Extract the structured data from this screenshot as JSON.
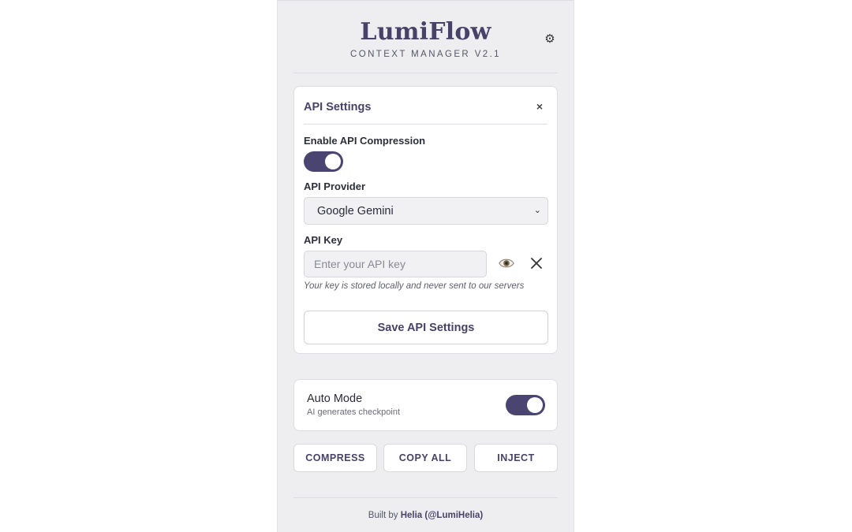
{
  "header": {
    "title": "LumiFlow",
    "subtitle": "CONTEXT MANAGER V2.1",
    "settings_icon": "gear-icon"
  },
  "api_settings": {
    "title": "API Settings",
    "close_glyph": "×",
    "compression_label": "Enable API Compression",
    "compression_enabled": true,
    "provider_label": "API Provider",
    "provider_value": "Google Gemini",
    "key_label": "API Key",
    "key_value": "",
    "key_placeholder": "Enter your API key",
    "hint": "Your key is stored locally and never sent to our servers",
    "save_label": "Save API Settings"
  },
  "auto_mode": {
    "title": "Auto Mode",
    "subtitle": "AI generates checkpoint",
    "enabled": true
  },
  "actions": {
    "compress": "COMPRESS",
    "copy_all": "COPY ALL",
    "inject": "INJECT"
  },
  "footer": {
    "prefix": "Built by",
    "author": "Helia (@LumiHelia)"
  },
  "colors": {
    "accent": "#4a4470",
    "panel_bg": "#eeeef1",
    "card_bg": "#ffffff"
  }
}
